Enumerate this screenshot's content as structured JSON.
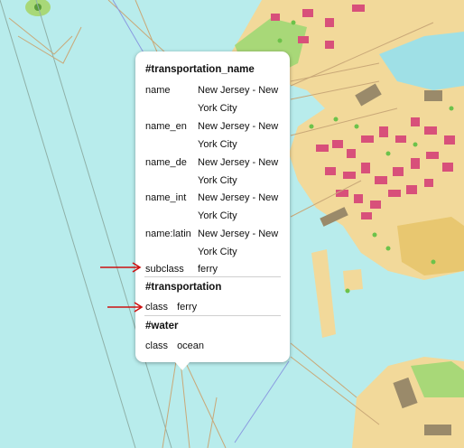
{
  "popup": {
    "sections": [
      {
        "title": "#transportation_name",
        "rows": [
          {
            "key": "name",
            "value": "New Jersey - New York City"
          },
          {
            "key": "name_en",
            "value": "New Jersey - New York City"
          },
          {
            "key": "name_de",
            "value": "New Jersey - New York City"
          },
          {
            "key": "name_int",
            "value": "New Jersey - New York City"
          },
          {
            "key": "name:latin",
            "value": "New Jersey - New York City"
          },
          {
            "key": "subclass",
            "value": "ferry"
          }
        ]
      },
      {
        "title": "#transportation",
        "rows": [
          {
            "key": "class",
            "value": "ferry"
          }
        ]
      },
      {
        "title": "#water",
        "rows": [
          {
            "key": "class",
            "value": "ocean"
          }
        ]
      }
    ]
  },
  "colors": {
    "water": "#b8ecec",
    "land": "#f2d99a",
    "park": "#a8d878",
    "building": "#d8507a",
    "arrow": "#cc1111"
  }
}
